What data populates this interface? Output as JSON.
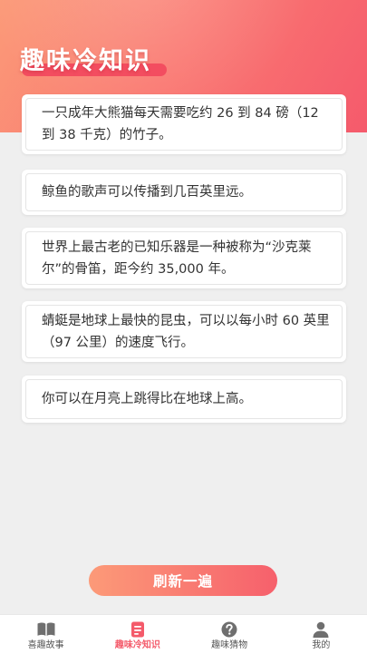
{
  "header": {
    "title": "趣味冷知识"
  },
  "facts": [
    {
      "text": "一只成年大熊猫每天需要吃约 26 到 84 磅（12 到 38 千克）的竹子。"
    },
    {
      "text": "鲸鱼的歌声可以传播到几百英里远。"
    },
    {
      "text": "世界上最古老的已知乐器是一种被称为“沙克莱尔”的骨笛，距今约 35,000 年。"
    },
    {
      "text": "蜻蜓是地球上最快的昆虫，可以以每小时 60 英里（97 公里）的速度飞行。"
    },
    {
      "text": "你可以在月亮上跳得比在地球上高。"
    }
  ],
  "refresh_label": "刷新一遍",
  "tabs": [
    {
      "label": "喜趣故事",
      "icon": "book-icon",
      "active": false
    },
    {
      "label": "趣味冷知识",
      "icon": "note-icon",
      "active": true
    },
    {
      "label": "趣味猜物",
      "icon": "question-icon",
      "active": false
    },
    {
      "label": "我的",
      "icon": "person-icon",
      "active": false
    }
  ],
  "colors": {
    "accent": "#f45a6a",
    "header_start": "#fb9a78",
    "header_end": "#f55a6c",
    "background": "#efefef",
    "inactive_icon": "#6f6f6f"
  }
}
